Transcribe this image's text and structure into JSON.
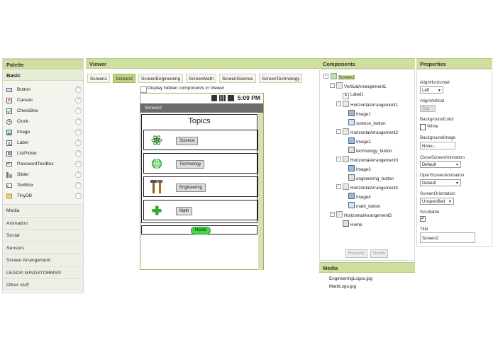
{
  "palette": {
    "title": "Palette",
    "basic_label": "Basic",
    "basic_items": [
      {
        "label": "Button",
        "icon": "button-icon"
      },
      {
        "label": "Canvas",
        "icon": "canvas-icon"
      },
      {
        "label": "CheckBox",
        "icon": "checkbox-icon"
      },
      {
        "label": "Clock",
        "icon": "clock-icon"
      },
      {
        "label": "Image",
        "icon": "image-icon"
      },
      {
        "label": "Label",
        "icon": "label-icon"
      },
      {
        "label": "ListPicker",
        "icon": "listpicker-icon"
      },
      {
        "label": "PasswordTextBox",
        "icon": "password-icon"
      },
      {
        "label": "Slider",
        "icon": "slider-icon"
      },
      {
        "label": "TextBox",
        "icon": "textbox-icon"
      },
      {
        "label": "TinyDB",
        "icon": "tinydb-icon"
      }
    ],
    "help_glyph": "?",
    "categories": [
      "Media",
      "Animation",
      "Social",
      "Sensors",
      "Screen Arrangement",
      "LEGO® MINDSTORMS®",
      "Other stuff"
    ]
  },
  "viewer": {
    "title": "Viewer",
    "tabs": [
      "Screen1",
      "Screen2",
      "ScreenEngineering",
      "ScreenMath",
      "ScreenScience",
      "ScreenTechnology"
    ],
    "active_tab": "Screen2",
    "hidden_components_label": "Display hidden components in Viewer",
    "phone": {
      "time": "5:09 PM",
      "screen_title": "Screen2",
      "topics_label": "Topics",
      "buttons": [
        "Science",
        "Technology",
        "Engineering",
        "Math"
      ],
      "home_button": "Home"
    }
  },
  "components": {
    "title": "Components",
    "tree": [
      {
        "label": "Screen2",
        "level": 0
      },
      {
        "label": "VerticalArrangement1",
        "level": 1
      },
      {
        "label": "Label1",
        "level": 2
      },
      {
        "label": "HorizontalArrangement1",
        "level": 2
      },
      {
        "label": "Image1",
        "level": 3
      },
      {
        "label": "science_button",
        "level": 3
      },
      {
        "label": "HorizontalArrangement2",
        "level": 2
      },
      {
        "label": "Image2",
        "level": 3
      },
      {
        "label": "technology_button",
        "level": 3
      },
      {
        "label": "HorizontalArrangement3",
        "level": 2
      },
      {
        "label": "Image3",
        "level": 3
      },
      {
        "label": "engineering_button",
        "level": 3
      },
      {
        "label": "HorizontalArrangement4",
        "level": 2
      },
      {
        "label": "Image4",
        "level": 3
      },
      {
        "label": "math_button",
        "level": 3
      },
      {
        "label": "HorizontalArrangement5",
        "level": 1
      },
      {
        "label": "Home",
        "level": 2
      }
    ],
    "rename_label": "Rename",
    "delete_label": "Delete"
  },
  "media": {
    "title": "Media",
    "files": [
      "EngineeringLogos.jpg",
      "MathLogo.jpg"
    ]
  },
  "properties": {
    "title": "Properties",
    "align_horizontal_label": "AlignHorizontal",
    "align_horizontal_value": "Left",
    "align_vertical_label": "AlignVertical",
    "align_vertical_value": "Top",
    "background_color_label": "BackgroundColor",
    "background_color_value": "White",
    "background_image_label": "BackgroundImage",
    "background_image_value": "None...",
    "close_anim_label": "CloseScreenAnimation",
    "close_anim_value": "Default",
    "open_anim_label": "OpenScreenAnimation",
    "open_anim_value": "Default",
    "orientation_label": "ScreenOrientation",
    "orientation_value": "Unspecified",
    "scrollable_label": "Scrollable",
    "scrollable_checked": true,
    "title_label": "Title",
    "title_value": "Screen2"
  },
  "colors": {
    "header_green": "#cfe09e",
    "active_tab": "#bfd47f",
    "home_button": "#44d640"
  }
}
